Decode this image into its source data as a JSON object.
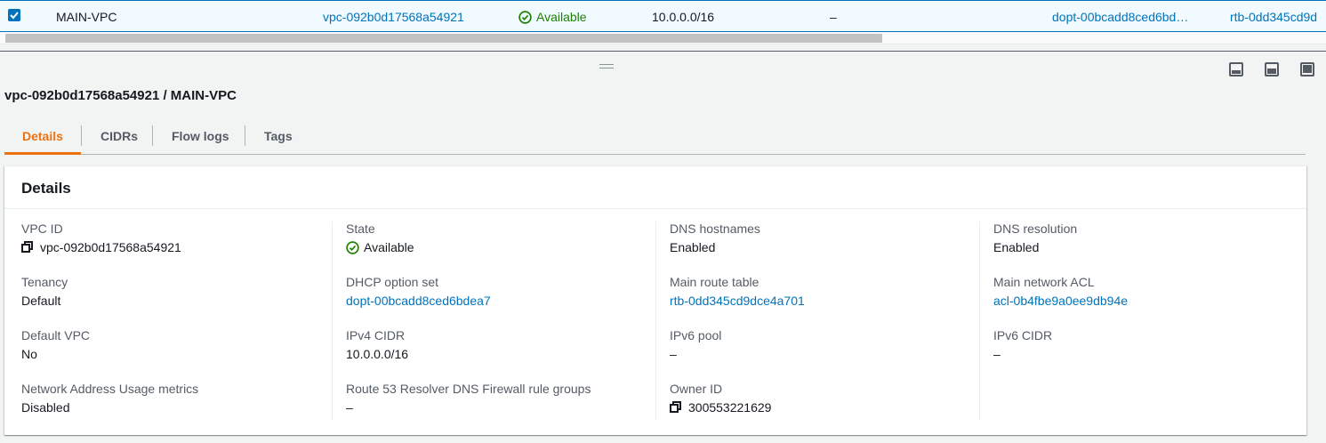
{
  "table_row": {
    "name": "MAIN-VPC",
    "vpc_id": "vpc-092b0d17568a54921",
    "state": "Available",
    "ipv4_cidr": "10.0.0.0/16",
    "ipv6_cidr": "–",
    "dhcp_option_set": "dopt-00bcadd8ced6bd…",
    "route_table": "rtb-0dd345cd9d"
  },
  "split_panel": {
    "title": "vpc-092b0d17568a54921 / MAIN-VPC",
    "tabs": [
      {
        "label": "Details"
      },
      {
        "label": "CIDRs"
      },
      {
        "label": "Flow logs"
      },
      {
        "label": "Tags"
      }
    ],
    "details_heading": "Details",
    "fields": {
      "vpc_id": {
        "key": "VPC ID",
        "value": "vpc-092b0d17568a54921"
      },
      "tenancy": {
        "key": "Tenancy",
        "value": "Default"
      },
      "default_vpc": {
        "key": "Default VPC",
        "value": "No"
      },
      "nau_metrics": {
        "key": "Network Address Usage metrics",
        "value": "Disabled"
      },
      "state": {
        "key": "State",
        "value": "Available"
      },
      "dhcp": {
        "key": "DHCP option set",
        "value": "dopt-00bcadd8ced6bdea7"
      },
      "ipv4_cidr": {
        "key": "IPv4 CIDR",
        "value": "10.0.0.0/16"
      },
      "r53": {
        "key": "Route 53 Resolver DNS Firewall rule groups",
        "value": "–"
      },
      "dns_hostnames": {
        "key": "DNS hostnames",
        "value": "Enabled"
      },
      "main_route_table": {
        "key": "Main route table",
        "value": "rtb-0dd345cd9dce4a701"
      },
      "ipv6_pool": {
        "key": "IPv6 pool",
        "value": "–"
      },
      "owner_id": {
        "key": "Owner ID",
        "value": "300553221629"
      },
      "dns_resolution": {
        "key": "DNS resolution",
        "value": "Enabled"
      },
      "main_acl": {
        "key": "Main network ACL",
        "value": "acl-0b4fbe9a0ee9db94e"
      },
      "ipv6_cidr": {
        "key": "IPv6 CIDR",
        "value": "–"
      }
    }
  },
  "colors": {
    "link": "#0073bb",
    "success": "#1d8102",
    "active_tab": "#ec7211",
    "selected_row_bg": "#f1faff"
  },
  "icons": [
    "checkbox-checked-icon",
    "status-available-icon",
    "copy-icon",
    "drag-handle-icon",
    "panel-position-icon"
  ]
}
